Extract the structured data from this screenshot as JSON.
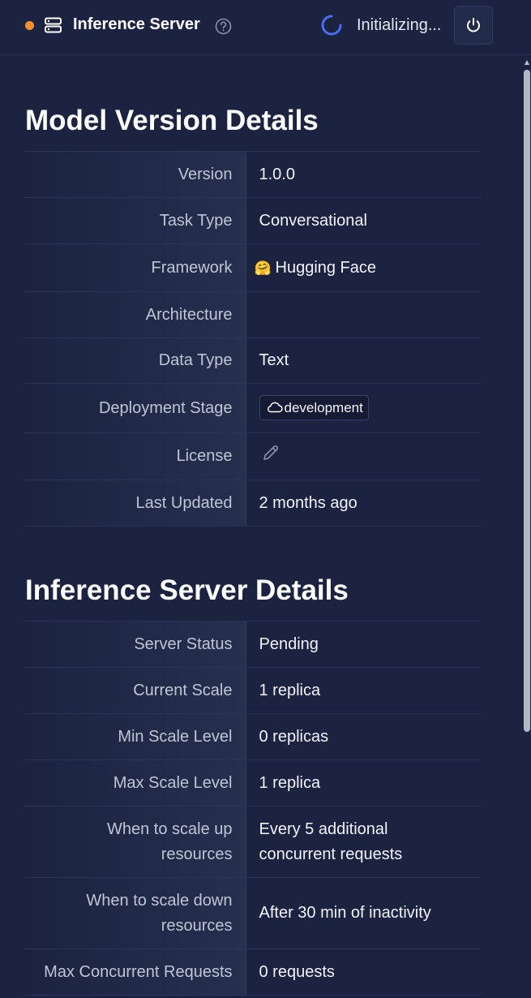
{
  "header": {
    "title": "Inference Server",
    "status_text": "Initializing...",
    "colors": {
      "status_dot": "#f5902f",
      "spinner": "#4a6cf0"
    }
  },
  "model_section": {
    "title": "Model Version Details",
    "rows": [
      {
        "label": "Version",
        "value": "1.0.0"
      },
      {
        "label": "Task Type",
        "value": "Conversational"
      },
      {
        "label": "Framework",
        "value": "Hugging Face",
        "icon": "🤗"
      },
      {
        "label": "Architecture",
        "value": ""
      },
      {
        "label": "Data Type",
        "value": "Text"
      },
      {
        "label": "Deployment Stage",
        "value": "development",
        "icon": "cloud-icon"
      },
      {
        "label": "License",
        "value": "",
        "icon": "pencil-edit-icon"
      },
      {
        "label": "Last Updated",
        "value": "2 months ago"
      }
    ]
  },
  "server_section": {
    "title": "Inference Server Details",
    "rows": [
      {
        "label": "Server Status",
        "value": "Pending"
      },
      {
        "label": "Current Scale",
        "value": "1 replica"
      },
      {
        "label": "Min Scale Level",
        "value": "0 replicas"
      },
      {
        "label": "Max Scale Level",
        "value": "1 replica"
      },
      {
        "label": "When to scale up resources",
        "value": "Every 5 additional concurrent requests"
      },
      {
        "label": "When to scale down resources",
        "value": "After 30 min of inactivity"
      },
      {
        "label": "Max Concurrent Requests",
        "value": "0 requests"
      }
    ]
  }
}
